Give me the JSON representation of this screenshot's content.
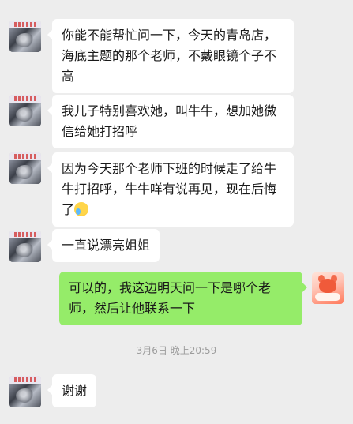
{
  "messages": [
    {
      "sender": "contact",
      "text": "你能不能帮忙问一下，今天的青岛店，海底主题的那个老师，不戴眼镜个子不高"
    },
    {
      "sender": "contact",
      "text": "我儿子特别喜欢她，叫牛牛，想加她微信给她打招呼"
    },
    {
      "sender": "contact",
      "text": "因为今天那个老师下班的时候走了给牛牛打招呼，牛牛咩有说再见，现在后悔了",
      "emoji": "crying-laughing-emoji"
    },
    {
      "sender": "contact",
      "text": "一直说漂亮姐姐"
    },
    {
      "sender": "self",
      "text": "可以的，我这边明天问一下是哪个老师，然后让他联系一下"
    },
    {
      "sender": "contact",
      "text": "谢谢"
    }
  ],
  "timestamp": "3月6日 晚上20:59",
  "colors": {
    "background": "#ededed",
    "incoming_bubble": "#ffffff",
    "outgoing_bubble": "#95ec69"
  }
}
